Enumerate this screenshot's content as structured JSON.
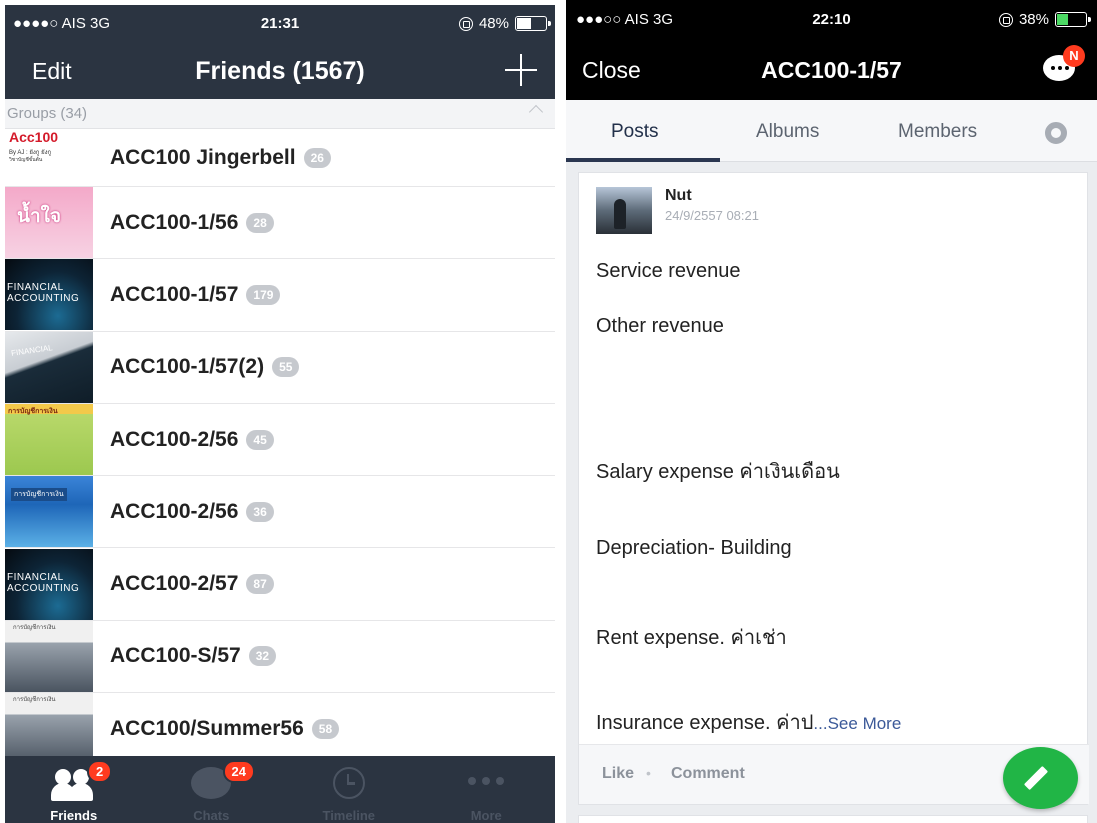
{
  "left": {
    "status": {
      "carrier": "●●●●○ AIS  3G",
      "time": "21:31",
      "battery": "48%",
      "battery_level": 0.48
    },
    "navbar": {
      "edit": "Edit",
      "title": "Friends (1567)"
    },
    "groups_header": "Groups (34)",
    "groups": [
      {
        "name": "ACC100 Jingerbell",
        "count": "26",
        "thumb_text": "Acc100",
        "thumb_sub": "By AJ : ยังกู ยังกู",
        "thumb_sub2": "วิชาบัญชีขั้นต้น"
      },
      {
        "name": "ACC100-1/56",
        "count": "28",
        "thumb_text": "น้ำใจ"
      },
      {
        "name": "ACC100-1/57",
        "count": "179",
        "thumb_text": "FINANCIAL ACCOUNTING"
      },
      {
        "name": "ACC100-1/57(2)",
        "count": "55",
        "thumb_text": "FINANCIAL"
      },
      {
        "name": "ACC100-2/56",
        "count": "45",
        "thumb_text": "การบัญชีการเงิน"
      },
      {
        "name": "ACC100-2/56",
        "count": "36",
        "thumb_text": "การบัญชีการเงิน"
      },
      {
        "name": "ACC100-2/57",
        "count": "87",
        "thumb_text": "FINANCIAL ACCOUNTING"
      },
      {
        "name": "ACC100-S/57",
        "count": "32",
        "thumb_text": "การบัญชีการเงิน"
      },
      {
        "name": "ACC100/Summer56",
        "count": "58",
        "thumb_text": "การบัญชีการเงิน"
      }
    ],
    "tabs": [
      {
        "label": "Friends",
        "badge": "2",
        "icon": "friends-icon"
      },
      {
        "label": "Chats",
        "badge": "24",
        "icon": "chat-icon"
      },
      {
        "label": "Timeline",
        "icon": "clock-icon"
      },
      {
        "label": "More",
        "icon": "more-icon"
      }
    ]
  },
  "right": {
    "status": {
      "carrier": "●●●○○ AIS  3G",
      "time": "22:10",
      "battery": "38%",
      "battery_level": 0.38
    },
    "navbar": {
      "close": "Close",
      "title": "ACC100-1/57",
      "badge": "N"
    },
    "tabs": [
      "Posts",
      "Albums",
      "Members"
    ],
    "post": {
      "author": "Nut",
      "timestamp": "24/9/2557 08:21",
      "lines": [
        "Service revenue",
        "Other revenue",
        "Salary expense  ค่าเงินเดือน",
        "Depreciation- Building",
        "Rent expense. ค่าเช่า",
        "Insurance expense. ค่าป"
      ],
      "see_more": "...See More",
      "like": "Like",
      "separator": "•",
      "comment": "Comment"
    }
  },
  "colors": {
    "nav_bg": "#2b3441",
    "badge_red": "#ff3b1f",
    "fab_green": "#21b546",
    "count_grey": "#c6c9ce"
  }
}
